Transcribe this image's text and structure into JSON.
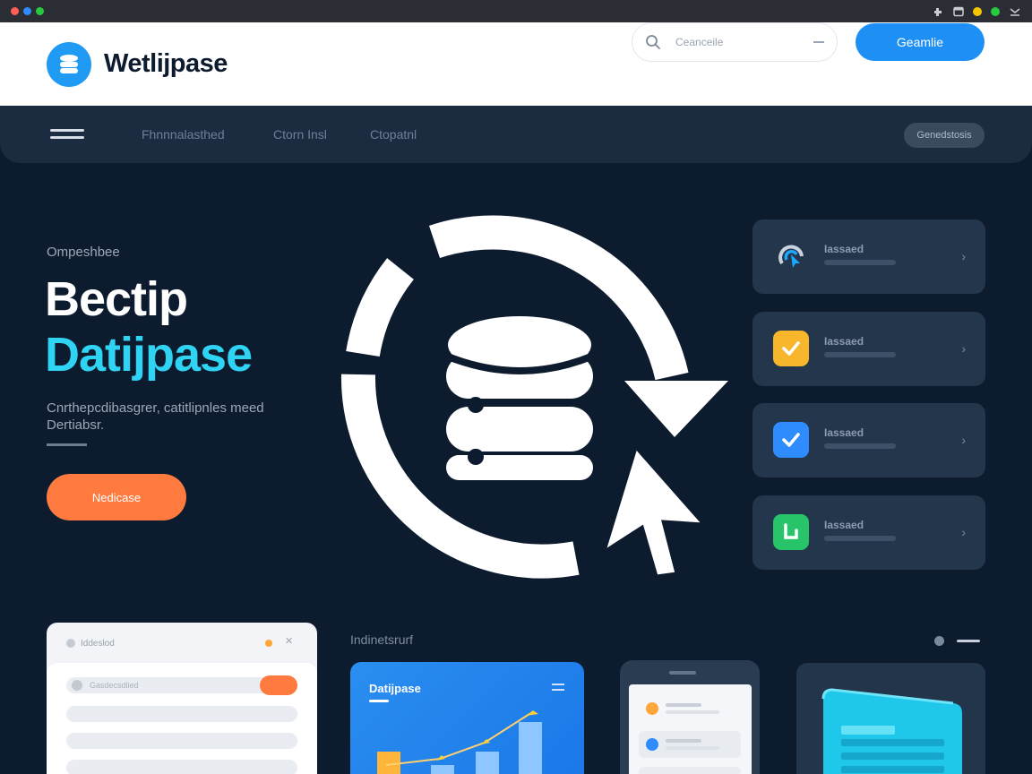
{
  "window": {
    "chrome_dots": [
      "#ff5f56",
      "#2f8cff",
      "#27c93f"
    ],
    "chrome_icons": [
      "puzzle-icon",
      "window-icon",
      "minimize-icon"
    ],
    "chrome_status_dots": [
      "#f7c600",
      "#27c93f"
    ]
  },
  "header": {
    "brand": "Wetlijpase",
    "search_placeholder": "Ceanceile",
    "cta_label": "Geamlie"
  },
  "nav": {
    "links": [
      "Fhnnnalasthed",
      "Ctorn Insl",
      "Ctopatnl"
    ],
    "pill_label": "Genedstosis"
  },
  "hero": {
    "eyebrow": "Ompeshbee",
    "headline_line1": "Bectip",
    "headline_line2": "Datijpase",
    "description": "Cnrthepcdibasgrer, catitlipnles meed Dertiabsr.",
    "cta_label": "Nedicase"
  },
  "feature_cards": [
    {
      "title": "Iassaed",
      "icon": "refresh-cursor-icon",
      "color": "#1a2a3f"
    },
    {
      "title": "Iassaed",
      "icon": "check-icon",
      "color": "#f8b62d"
    },
    {
      "title": "Iassaed",
      "icon": "check-icon",
      "color": "#2f8cff"
    },
    {
      "title": "Iassaed",
      "icon": "database-icon",
      "color": "#27c46a"
    }
  ],
  "bottom": {
    "panel_title": "Iddeslod",
    "panel_rows": [
      "Gasdecsdlied",
      "",
      "",
      ""
    ],
    "section_label": "Indinetsrurf",
    "chart_card_title": "Datijpase",
    "colors": {
      "accent_orange": "#ff7a3f",
      "accent_blue": "#1e90f5",
      "accent_cyan": "#2fd4f4"
    }
  }
}
